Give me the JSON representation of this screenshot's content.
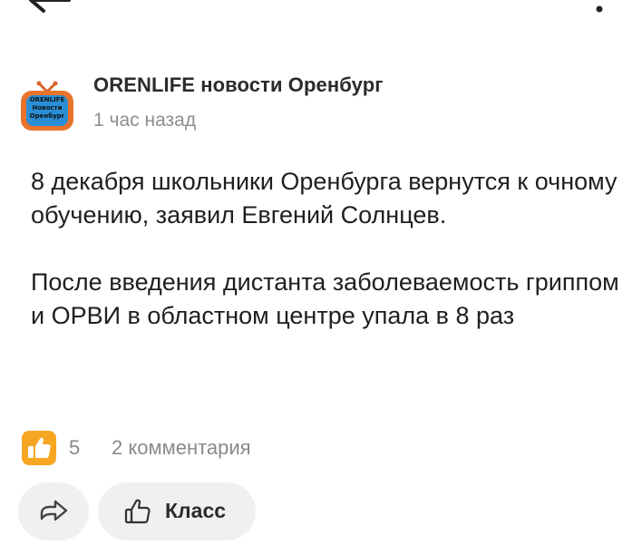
{
  "post": {
    "author": "ORENLIFE новости Оренбург",
    "time": "1 час назад",
    "avatar_text": [
      "ORENLIFE",
      "Новости",
      "Оренбург"
    ],
    "paragraphs": [
      "8 декабря школьники Оренбурга вернутся к очному обучению, заявил Евгений Солнцев.",
      "После введения дистанта заболеваемость гриппом и ОРВИ в областном центре упала в 8 раз"
    ]
  },
  "stats": {
    "likes": "5",
    "comments": "2 комментария"
  },
  "actions": {
    "klass_label": "Класс"
  },
  "icons": {
    "back": "arrow-left-icon",
    "more": "more-vertical-icon",
    "like": "thumbs-up-icon",
    "share": "share-arrow-icon",
    "klass": "thumbs-up-outline-icon"
  },
  "colors": {
    "like_badge": "#f6a623",
    "avatar_frame": "#e8742c",
    "avatar_screen": "#2a8fd6",
    "button_bg": "#f0f0f0",
    "muted_text": "#8e8e8e"
  }
}
